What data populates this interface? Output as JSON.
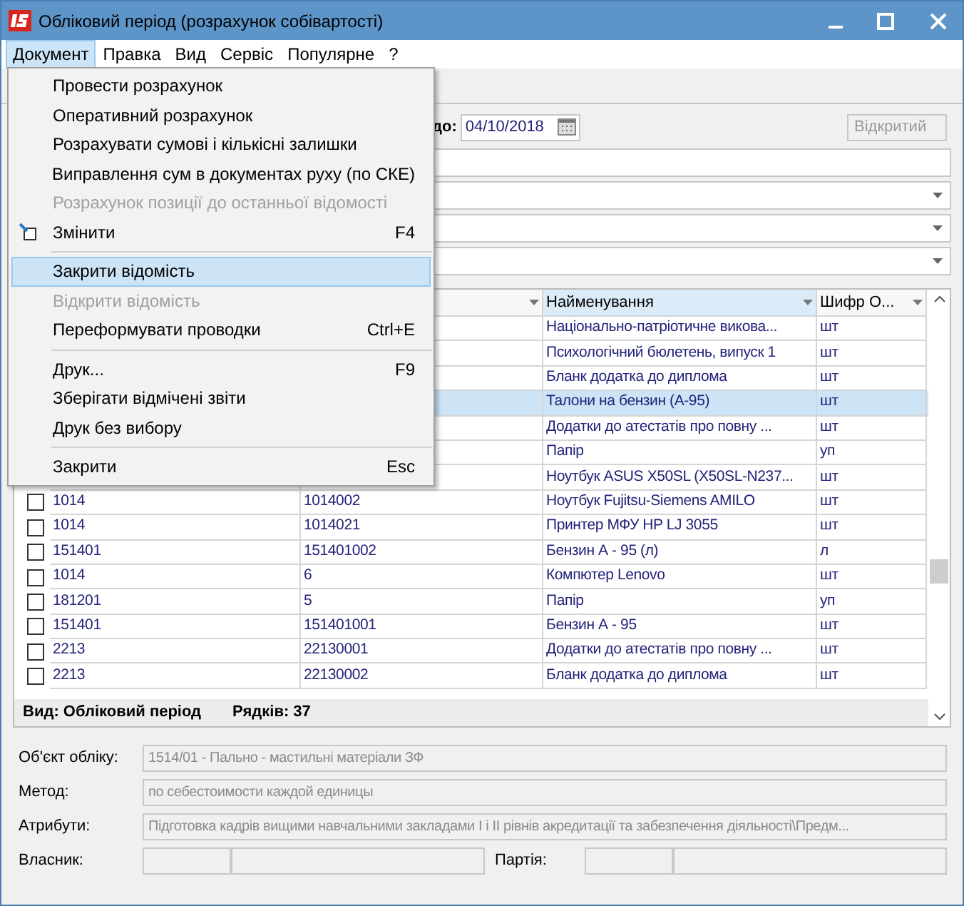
{
  "window": {
    "title": "Обліковий період (розрахунок собівартості)"
  },
  "menu_bar": [
    {
      "label": "Документ",
      "selected": true
    },
    {
      "label": "Правка",
      "selected": false
    },
    {
      "label": "Вид",
      "selected": false
    },
    {
      "label": "Сервіс",
      "selected": false
    },
    {
      "label": "Популярне",
      "selected": false
    },
    {
      "label": "?",
      "selected": false
    }
  ],
  "menu": [
    {
      "kind": "item",
      "label": "Провести розрахунок",
      "selected": false,
      "disabled": false
    },
    {
      "kind": "item",
      "label": "Оперативний розрахунок",
      "selected": false,
      "disabled": false
    },
    {
      "kind": "item",
      "label": "Розрахувати сумові і кількісні залишки",
      "selected": false,
      "disabled": false
    },
    {
      "kind": "item",
      "label": "Виправлення сум в документах руху (по СКЕ)",
      "selected": false,
      "disabled": false
    },
    {
      "kind": "item",
      "label": "Розрахунок позиції до останньої відомості",
      "selected": false,
      "disabled": true
    },
    {
      "kind": "item",
      "label": "Змінити",
      "shortcut": "F4",
      "icon": true,
      "selected": false,
      "disabled": false
    },
    {
      "kind": "separator"
    },
    {
      "kind": "item",
      "label": "Закрити відомість",
      "selected": true,
      "disabled": false
    },
    {
      "kind": "item",
      "label": "Відкрити відомість",
      "selected": false,
      "disabled": true
    },
    {
      "kind": "item",
      "label": "Переформувати проводки",
      "shortcut": "Ctrl+E",
      "selected": false,
      "disabled": false
    },
    {
      "kind": "separator"
    },
    {
      "kind": "item",
      "label": "Друк...",
      "shortcut": "F9",
      "selected": false,
      "disabled": false
    },
    {
      "kind": "item",
      "label": "Зберігати відмічені звіти",
      "selected": false,
      "disabled": false
    },
    {
      "kind": "item",
      "label": "Друк без вибору",
      "selected": false,
      "disabled": false
    },
    {
      "kind": "separator"
    },
    {
      "kind": "item",
      "label": "Закрити",
      "shortcut": "Esc",
      "selected": false,
      "disabled": false
    }
  ],
  "period": {
    "to_label": "до:",
    "to_date": "04/10/2018",
    "status": "Відкритий"
  },
  "table": {
    "columns": [
      {},
      {},
      {
        "label": "Найменування"
      },
      {
        "label": "Шифр О..."
      }
    ],
    "rows": [
      {
        "name": "Національно-патріотичне викова...",
        "unit": "шт",
        "selected": false
      },
      {
        "name": "Психологічний бюлетень, випуск 1",
        "unit": "шт",
        "selected": false
      },
      {
        "name": "Бланк додатка до диплома",
        "unit": "шт",
        "selected": false
      },
      {
        "name": "Талони на бензин (А-95)",
        "unit": "шт",
        "selected": true
      },
      {
        "name": "Додатки до атестатів про повну ...",
        "unit": "шт",
        "selected": false
      },
      {
        "name": "Папір",
        "unit": "уп",
        "selected": false
      },
      {
        "name": "Ноутбук ASUS X50SL (X50SL-N237...",
        "unit": "шт",
        "selected": false
      },
      {
        "account": "1014",
        "code": "1014002",
        "name": "Ноутбук Fujitsu-Siemens AMILO",
        "unit": "шт",
        "selected": false,
        "checked": false
      },
      {
        "account": "1014",
        "code": "1014021",
        "name": "Принтер МФУ HP LJ 3055",
        "unit": "шт",
        "selected": false,
        "checked": false
      },
      {
        "account": "151401",
        "code": "151401002",
        "name": "Бензин А - 95 (л)",
        "unit": "л",
        "selected": false,
        "checked": false
      },
      {
        "account": "1014",
        "code": "6",
        "name": "Компютер Lenovo",
        "unit": "шт",
        "selected": false,
        "checked": false
      },
      {
        "account": "181201",
        "code": "5",
        "name": "Папір",
        "unit": "уп",
        "selected": false,
        "checked": false
      },
      {
        "account": "151401",
        "code": "151401001",
        "name": "Бензин А - 95",
        "unit": "шт",
        "selected": false,
        "checked": false
      },
      {
        "account": "2213",
        "code": "22130001",
        "name": "Додатки до атестатів про повну ...",
        "unit": "шт",
        "selected": false,
        "checked": false
      },
      {
        "account": "2213",
        "code": "22130002",
        "name": "Бланк додатка до диплома",
        "unit": "шт",
        "selected": false,
        "checked": false
      }
    ]
  },
  "status_bar": {
    "view": "Вид: Обліковий період",
    "rows": "Рядків: 37"
  },
  "details": [
    {
      "label": "Об'єкт обліку:",
      "value": "1514/01 - Пально - мастильні матеріали ЗФ"
    },
    {
      "label": "Метод:",
      "value": "по себестоимости каждой единицы"
    },
    {
      "label": "Атрибути:",
      "value": "Підготовка кадрів вищими навчальними закладами I і II рівнів акредитації та забезпечення діяльності\\Предм..."
    }
  ],
  "owner": {
    "label": "Власник:",
    "party_label": "Партія:"
  }
}
